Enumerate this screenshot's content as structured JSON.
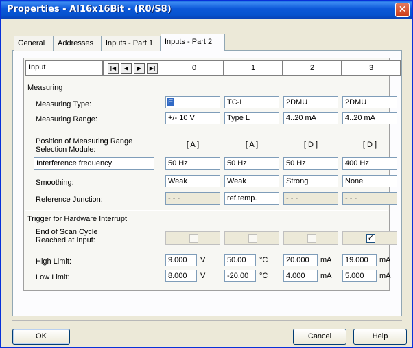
{
  "window": {
    "title": "Properties - AI16x16Bit - (R0/S8)",
    "close_glyph": "✕"
  },
  "tabs": [
    {
      "label": "General"
    },
    {
      "label": "Addresses"
    },
    {
      "label": "Inputs - Part 1"
    },
    {
      "label": "Inputs - Part 2",
      "active": true
    }
  ],
  "header": {
    "input_label": "Input",
    "nav": {
      "first": "|◀",
      "prev": "◀",
      "next": "▶",
      "last": "▶|"
    },
    "columns": [
      "0",
      "1",
      "2",
      "3"
    ]
  },
  "measuring": {
    "title": "Measuring",
    "type_label": "Measuring Type:",
    "range_label": "Measuring Range:",
    "position_label_1": "Position of Measuring Range",
    "position_label_2": "Selection Module:",
    "interference_label": "Interference frequency",
    "smoothing_label": "Smoothing:",
    "refjunction_label": "Reference Junction:",
    "types": [
      "E",
      "TC-L",
      "2DMU",
      "2DMU"
    ],
    "ranges": [
      "+/- 10 V",
      "Type L",
      "4..20 mA",
      "4..20 mA"
    ],
    "positions": [
      "[ A ]",
      "[ A ]",
      "[ D ]",
      "[ D ]"
    ],
    "interference": [
      "50 Hz",
      "50 Hz",
      "50 Hz",
      "400 Hz"
    ],
    "smoothing": [
      "Weak",
      "Weak",
      "Strong",
      "None"
    ],
    "refjunction": [
      "- - -",
      "ref.temp.",
      "- - -",
      "- - -"
    ]
  },
  "trigger": {
    "title": "Trigger for Hardware Interrupt",
    "end_scan_label_1": "End of Scan Cycle",
    "end_scan_label_2": "Reached at Input:",
    "end_scan_checked": [
      false,
      false,
      false,
      true
    ],
    "check_glyph": "✓",
    "high_label": "High Limit:",
    "low_label": "Low Limit:",
    "high": [
      {
        "value": "9.000",
        "unit": "V"
      },
      {
        "value": "50.00",
        "unit": "°C"
      },
      {
        "value": "20.000",
        "unit": "mA"
      },
      {
        "value": "19.000",
        "unit": "mA"
      }
    ],
    "low": [
      {
        "value": "8.000",
        "unit": "V"
      },
      {
        "value": "-20.00",
        "unit": "°C"
      },
      {
        "value": "4.000",
        "unit": "mA"
      },
      {
        "value": "5.000",
        "unit": "mA"
      }
    ]
  },
  "buttons": {
    "ok": "OK",
    "cancel": "Cancel",
    "help": "Help"
  }
}
